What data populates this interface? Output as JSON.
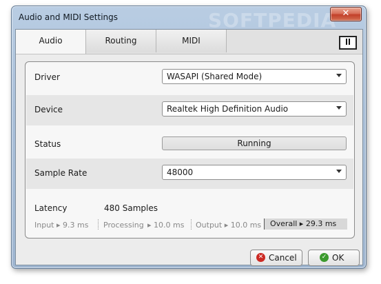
{
  "window": {
    "title": "Audio and MIDI Settings",
    "close_glyph": "✕",
    "watermark": "SOFTPEDIA"
  },
  "tabs": [
    {
      "label": "Audio",
      "active": true
    },
    {
      "label": "Routing",
      "active": false
    },
    {
      "label": "MIDI",
      "active": false
    }
  ],
  "logo": {
    "icon": "ni-logo",
    "text": "N I"
  },
  "settings": {
    "driver": {
      "label": "Driver",
      "value": "WASAPI (Shared Mode)"
    },
    "device": {
      "label": "Device",
      "value": "Realtek High Definition Audio"
    },
    "status": {
      "label": "Status",
      "value": "Running"
    },
    "sample_rate": {
      "label": "Sample Rate",
      "value": "48000"
    },
    "latency": {
      "label": "Latency",
      "value": "480 Samples"
    }
  },
  "latency_breakdown": {
    "input": "Input ▸ 9.3 ms",
    "processing_label": "Processing",
    "processing_value": "▸ 10.0 ms",
    "output": "Output ▸ 10.0 ms",
    "overall": "Overall ▸ 29.3 ms"
  },
  "buttons": {
    "cancel": {
      "label": "Cancel",
      "icon": "cancel-icon",
      "glyph": "✕"
    },
    "ok": {
      "label": "OK",
      "icon": "check-icon",
      "glyph": "✓"
    }
  },
  "colors": {
    "title_gradient": "#aac0d9",
    "cancel_icon": "#cc2a24",
    "ok_icon": "#3c9a2e"
  }
}
